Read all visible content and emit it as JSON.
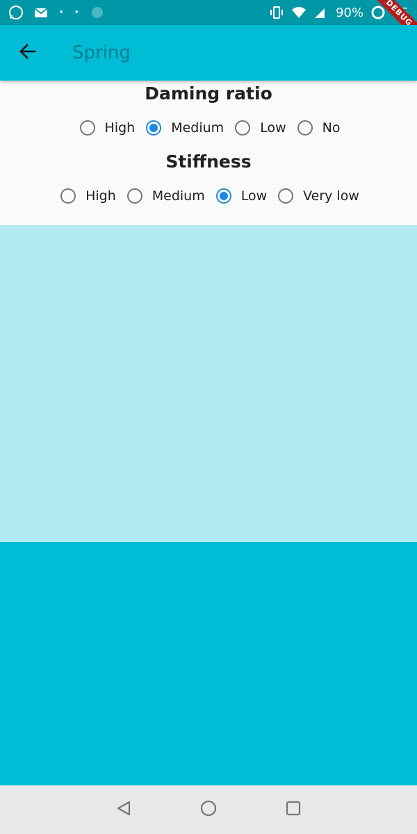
{
  "status_bar": {
    "battery": "90%",
    "time": "35",
    "debug": "DEBUG"
  },
  "app_bar": {
    "title": "Spring"
  },
  "damping": {
    "title": "Daming ratio",
    "options": [
      {
        "label": "High",
        "selected": false
      },
      {
        "label": "Medium",
        "selected": true
      },
      {
        "label": "Low",
        "selected": false
      },
      {
        "label": "No",
        "selected": false
      }
    ]
  },
  "stiffness": {
    "title": "Stiffness",
    "options": [
      {
        "label": "High",
        "selected": false
      },
      {
        "label": "Medium",
        "selected": false
      },
      {
        "label": "Low",
        "selected": true
      },
      {
        "label": "Very low",
        "selected": false
      }
    ]
  },
  "colors": {
    "primary": "#00BCD4",
    "primary_dark": "#0097A7",
    "light_cyan": "#B2EBF2",
    "accent": "#1E88E5"
  }
}
